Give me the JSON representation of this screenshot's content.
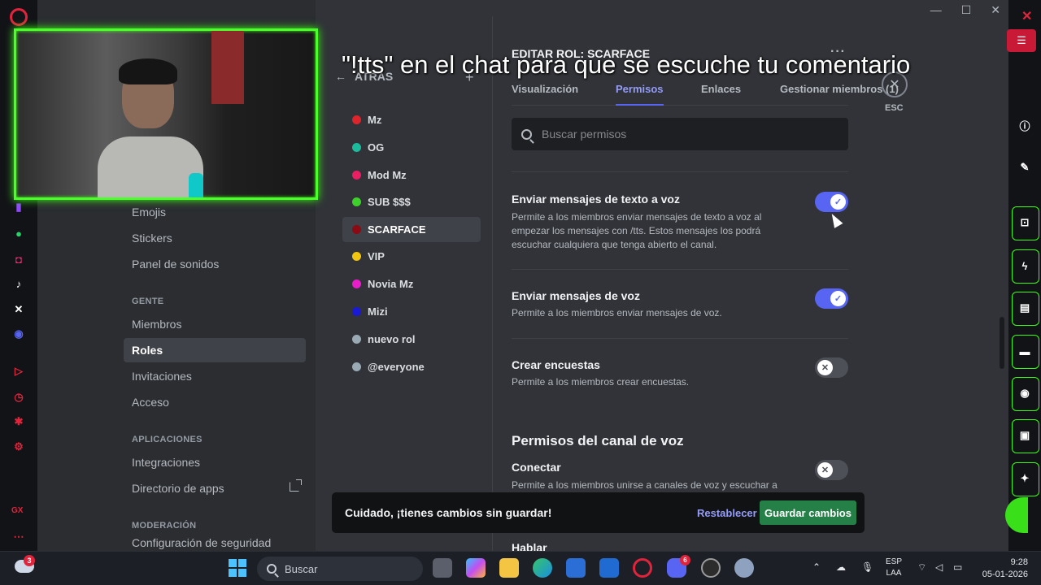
{
  "overlay": {
    "subtitle": "\"!tts\" en el chat para que se escuche tu comentario"
  },
  "sidebar": {
    "items_top": [
      {
        "label": "Emojis"
      },
      {
        "label": "Stickers"
      },
      {
        "label": "Panel de sonidos"
      }
    ],
    "gente_header": "GENTE",
    "gente_items": [
      {
        "label": "Miembros"
      },
      {
        "label": "Roles"
      },
      {
        "label": "Invitaciones"
      },
      {
        "label": "Acceso"
      }
    ],
    "apps_header": "APLICACIONES",
    "apps_items": [
      {
        "label": "Integraciones"
      },
      {
        "label": "Directorio de apps"
      }
    ],
    "mod_header": "MODERACIÓN",
    "mod_items": [
      {
        "label": "Configuración de seguridad"
      }
    ]
  },
  "roles": {
    "back_label": "ATRÁS",
    "add_icon": "plus-icon",
    "items": [
      {
        "label": "Mz",
        "color": "#e0242c"
      },
      {
        "label": "OG",
        "color": "#1abc9c"
      },
      {
        "label": "Mod Mz",
        "color": "#e91e63"
      },
      {
        "label": "SUB $$$",
        "color": "#3ed12b"
      },
      {
        "label": "SCARFACE",
        "color": "#8b0a14"
      },
      {
        "label": "VIP",
        "color": "#f1c40f"
      },
      {
        "label": "Novia Mz",
        "color": "#e91ec8"
      },
      {
        "label": "Mizi",
        "color": "#1a1ad6"
      },
      {
        "label": "nuevo rol",
        "color": "#99aab5"
      },
      {
        "label": "@everyone",
        "color": "#99aab5"
      }
    ],
    "active_index": 4
  },
  "editor": {
    "title": "EDITAR ROL: SCARFACE",
    "more": "···",
    "tabs": [
      {
        "label": "Visualización"
      },
      {
        "label": "Permisos"
      },
      {
        "label": "Enlaces"
      },
      {
        "label": "Gestionar miembros (1)"
      }
    ],
    "active_tab": 1,
    "esc_label": "ESC",
    "search_placeholder": "Buscar permisos",
    "permissions": [
      {
        "name": "Enviar mensajes de texto a voz",
        "desc": "Permite a los miembros enviar mensajes de texto a voz al empezar los mensajes con /tts. Estos mensajes los podrá escuchar cualquiera que tenga abierto el canal.",
        "enabled": true
      },
      {
        "name": "Enviar mensajes de voz",
        "desc": "Permite a los miembros enviar mensajes de voz.",
        "enabled": true
      },
      {
        "name": "Crear encuestas",
        "desc": "Permite a los miembros crear encuestas.",
        "enabled": false
      }
    ],
    "voice_section_title": "Permisos del canal de voz",
    "voice_permissions": [
      {
        "name": "Conectar",
        "desc": "Permite a los miembros unirse a canales de voz y escuchar a",
        "enabled": false
      }
    ],
    "below_bar_text": "Hablar"
  },
  "unsaved_bar": {
    "message": "Cuidado, ¡tienes cambios sin guardar!",
    "reset_label": "Restablecer",
    "save_label": "Guardar cambios"
  },
  "taskbar": {
    "weather_badge": "3",
    "search_placeholder": "Buscar",
    "discord_badge": "6",
    "lang_line1": "ESP",
    "lang_line2": "LAA",
    "time": "9:28",
    "date": "05-01-2026"
  },
  "gx": {
    "footer_label": "GX"
  },
  "colors": {
    "accent": "#5865f2",
    "save_green": "#248046",
    "gx_red": "#e0243c",
    "webcam_border": "#39ff14"
  }
}
